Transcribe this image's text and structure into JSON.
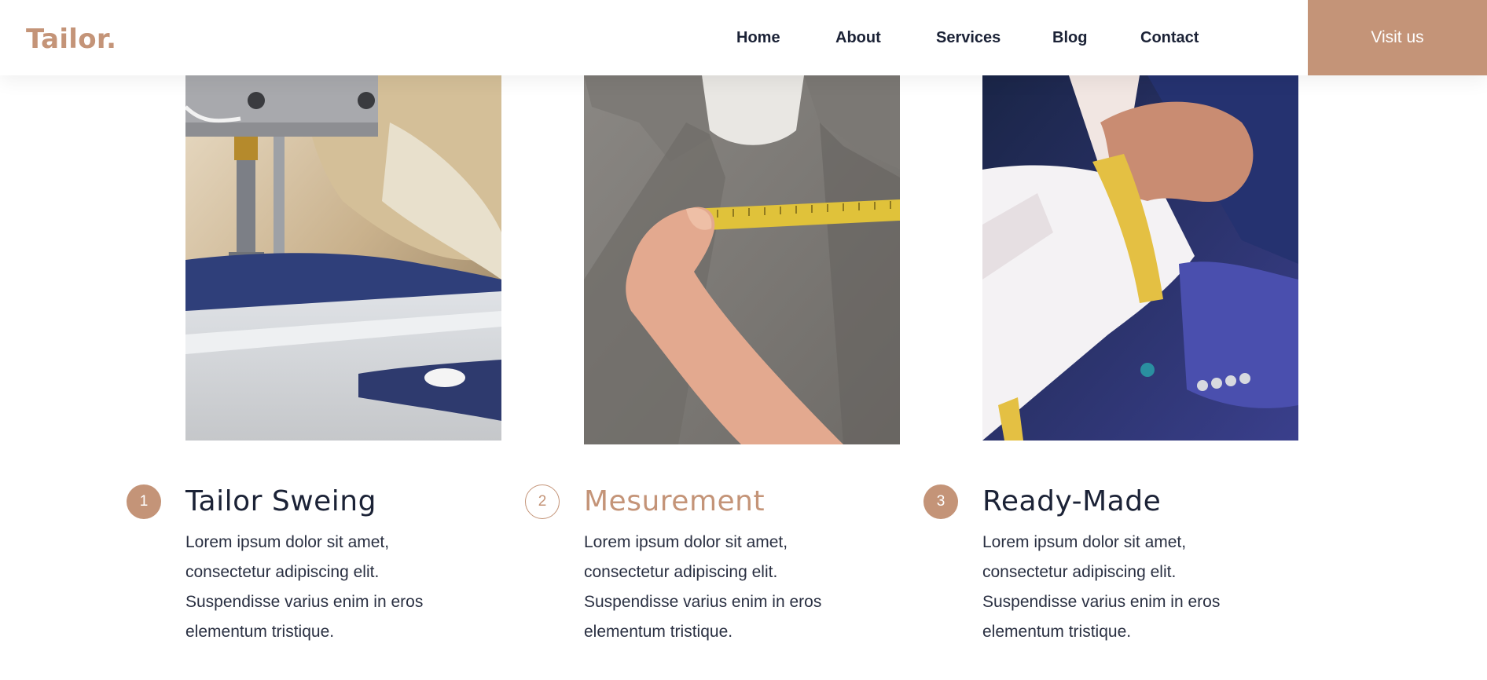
{
  "brand": {
    "logo": "Tailor."
  },
  "nav": {
    "items": [
      {
        "label": "Home"
      },
      {
        "label": "About"
      },
      {
        "label": "Services"
      },
      {
        "label": "Blog"
      },
      {
        "label": "Contact"
      }
    ],
    "cta": "Visit us"
  },
  "services": [
    {
      "number": "1",
      "title": "Tailor Sweing",
      "description": "Lorem ipsum dolor sit amet, consectetur adipiscing elit. Suspendisse varius enim in eros elementum tristique.",
      "image": "sewing-machine-photo"
    },
    {
      "number": "2",
      "title": "Mesurement",
      "description": "Lorem ipsum dolor sit amet, consectetur adipiscing elit. Suspendisse varius enim in eros elementum tristique.",
      "image": "measuring-tape-chest-photo"
    },
    {
      "number": "3",
      "title": "Ready-Made",
      "description": "Lorem ipsum dolor sit amet, consectetur adipiscing elit. Suspendisse varius enim in eros elementum tristique.",
      "image": "sleeve-measurement-photo"
    }
  ],
  "colors": {
    "accent": "#c49478",
    "text": "#1b2236",
    "background": "#ffffff"
  }
}
